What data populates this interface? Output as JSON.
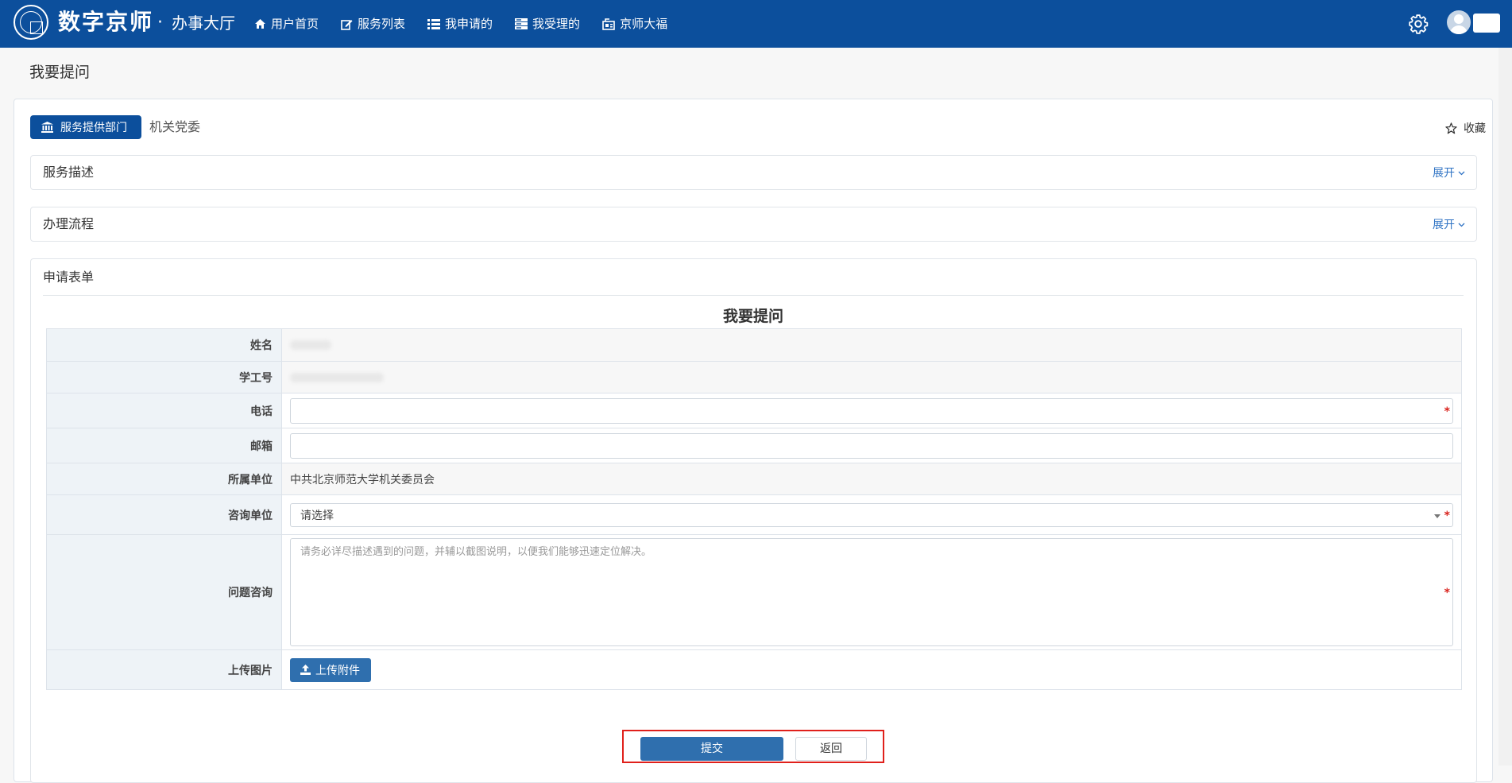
{
  "header": {
    "brand": "数字京师",
    "brand_dot": "·",
    "brand_sub": "办事大厅",
    "nav": [
      {
        "label": "用户首页",
        "icon": "home-icon"
      },
      {
        "label": "服务列表",
        "icon": "edit-icon"
      },
      {
        "label": "我申请的",
        "icon": "list-icon"
      },
      {
        "label": "我受理的",
        "icon": "server-icon"
      },
      {
        "label": "京师大福",
        "icon": "badge-icon"
      }
    ],
    "bg_color": "#0c4f9c"
  },
  "page": {
    "title": "我要提问"
  },
  "department": {
    "badge_label": "服务提供部门",
    "name": "机关党委",
    "favorite_label": "收藏"
  },
  "panels": [
    {
      "title": "服务描述",
      "toggle": "展开"
    },
    {
      "title": "办理流程",
      "toggle": "展开"
    }
  ],
  "form": {
    "section_title": "申请表单",
    "heading": "我要提问",
    "fields": {
      "name_label": "姓名",
      "id_label": "学工号",
      "phone_label": "电话",
      "email_label": "邮箱",
      "unit_label": "所属单位",
      "unit_value": "中共北京师范大学机关委员会",
      "consult_label": "咨询单位",
      "consult_value": "请选择",
      "question_label": "问题咨询",
      "question_placeholder": "请务必详尽描述遇到的问题，并辅以截图说明，以便我们能够迅速定位解决。",
      "upload_label": "上传图片",
      "upload_button": "上传附件"
    },
    "required_mark": "*"
  },
  "actions": {
    "submit": "提交",
    "back": "返回",
    "highlight_color": "#e0201b"
  }
}
